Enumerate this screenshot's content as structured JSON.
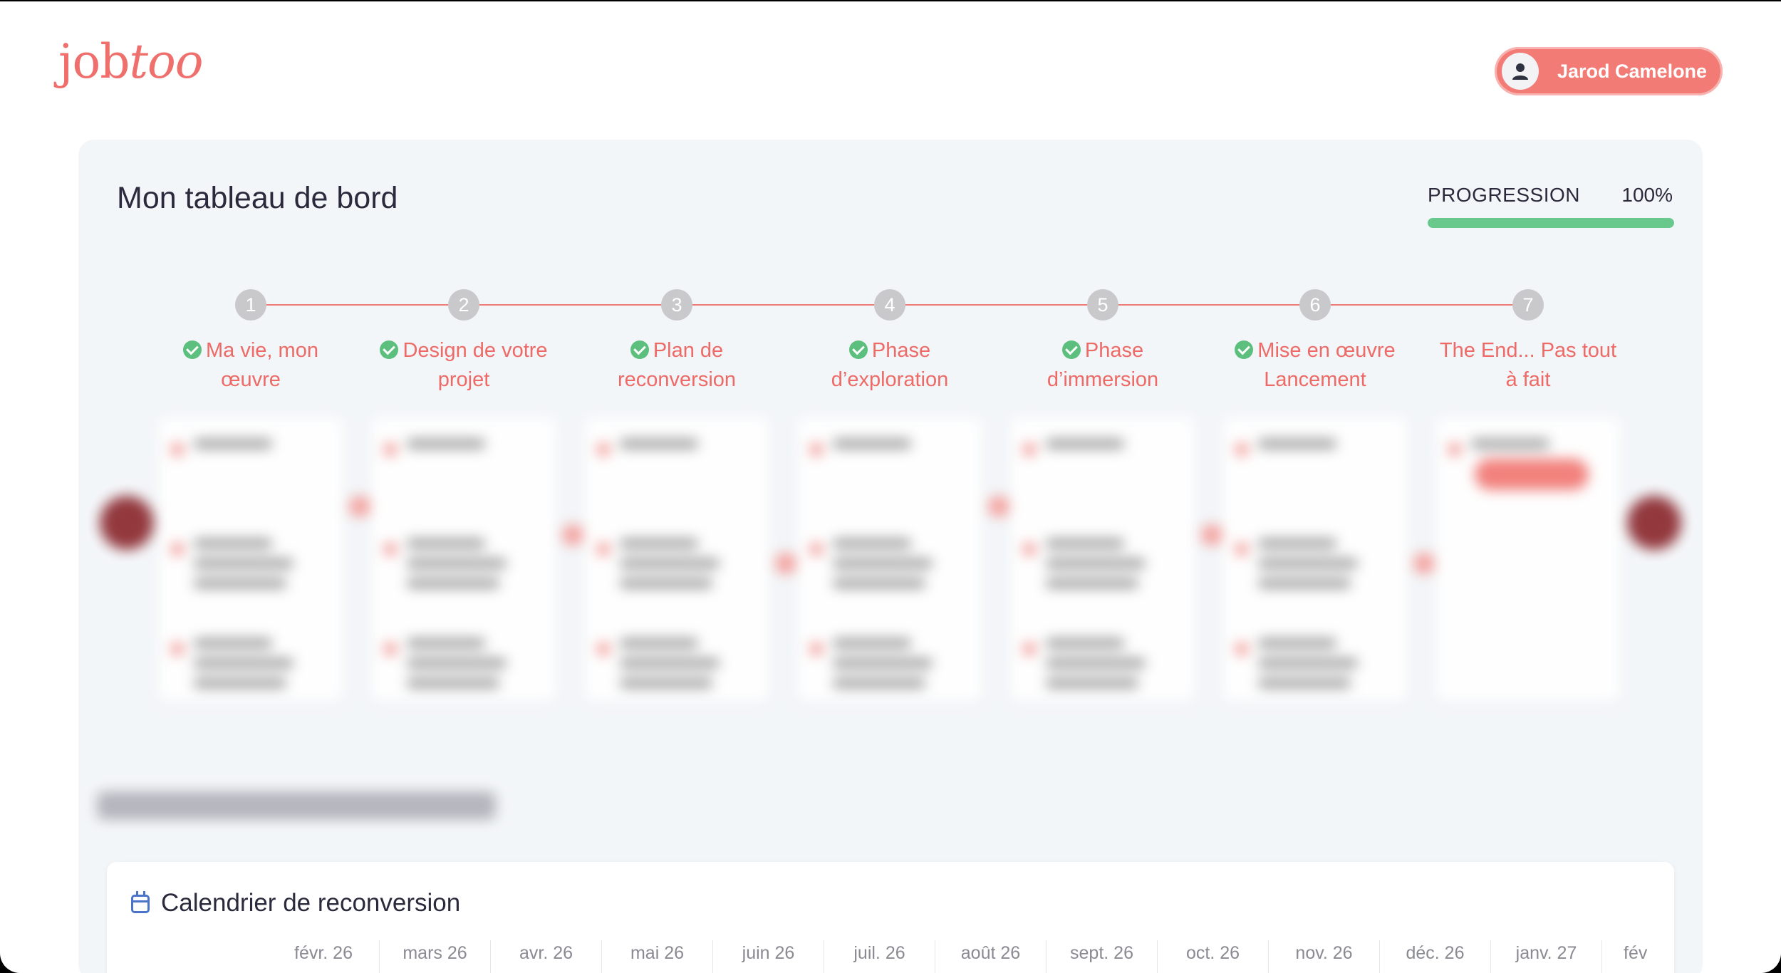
{
  "app": {
    "logo_plain": "job",
    "logo_script": "too"
  },
  "user": {
    "name": "Jarod Camelone"
  },
  "dashboard": {
    "title": "Mon tableau de bord",
    "progress_label": "PROGRESSION",
    "progress_value": "100%",
    "progress_fraction": 1.0
  },
  "colors": {
    "accent": "#ee6a66",
    "success": "#5cbf7d",
    "calendar_icon": "#4b73c9"
  },
  "steps": [
    {
      "num": "1",
      "label": "Ma vie, mon œuvre",
      "done": true
    },
    {
      "num": "2",
      "label": "Design de votre projet",
      "done": true
    },
    {
      "num": "3",
      "label": "Plan de reconversion",
      "done": true
    },
    {
      "num": "4",
      "label": "Phase d’exploration",
      "done": true
    },
    {
      "num": "5",
      "label": "Phase d’immersion",
      "done": true
    },
    {
      "num": "6",
      "label": "Mise en œuvre Lancement",
      "done": true
    },
    {
      "num": "7",
      "label": "The End... Pas tout à fait",
      "done": false
    }
  ],
  "calendar": {
    "title": "Calendrier de reconversion",
    "months": [
      "févr. 26",
      "mars 26",
      "avr. 26",
      "mai 26",
      "juin 26",
      "juil. 26",
      "août 26",
      "sept. 26",
      "oct. 26",
      "nov. 26",
      "déc. 26",
      "janv. 27",
      "fév"
    ]
  }
}
